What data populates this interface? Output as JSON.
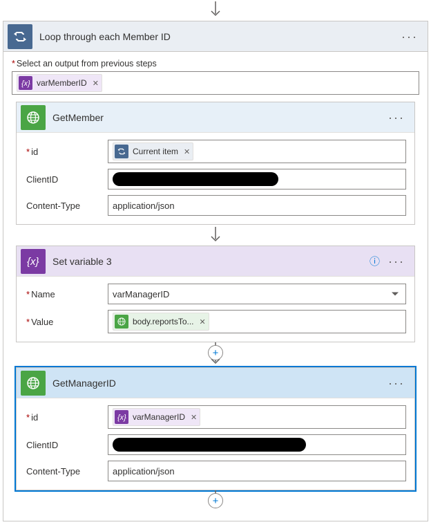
{
  "arrow": true,
  "loopCard": {
    "title": "Loop through each Member ID",
    "outputHint": "Select an output from previous steps",
    "outputToken": {
      "label": "varMemberID"
    }
  },
  "getMember": {
    "title": "GetMember",
    "rows": {
      "idLabel": "id",
      "idToken": "Current item",
      "clientIdLabel": "ClientID",
      "contentTypeLabel": "Content-Type",
      "contentTypeValue": "application/json"
    }
  },
  "setVar": {
    "title": "Set variable 3",
    "rows": {
      "nameLabel": "Name",
      "nameValue": "varManagerID",
      "valueLabel": "Value",
      "valueToken": "body.reportsTo..."
    }
  },
  "getManager": {
    "title": "GetManagerID",
    "rows": {
      "idLabel": "id",
      "idToken": "varManagerID",
      "clientIdLabel": "ClientID",
      "contentTypeLabel": "Content-Type",
      "contentTypeValue": "application/json"
    }
  }
}
